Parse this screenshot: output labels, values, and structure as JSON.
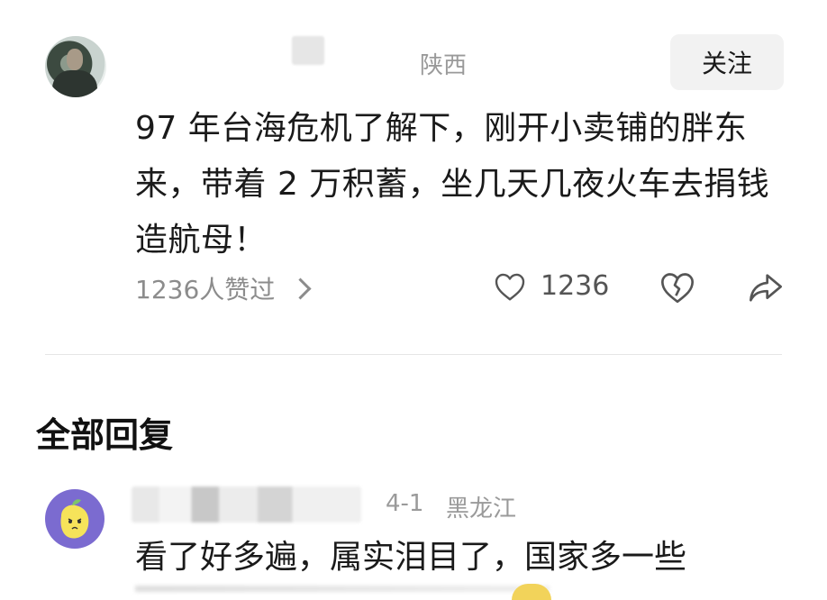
{
  "post": {
    "location": "陕西",
    "follow_label": "关注",
    "text": "97 年台海危机了解下，刚开小卖铺的胖东来，带着 2 万积蓄，坐几天几夜火车去捐钱造航母！",
    "likes_summary": "1236人赞过",
    "like_count": "1236"
  },
  "replies_section": {
    "title": "全部回复"
  },
  "reply": {
    "date": "4-1",
    "location": "黑龙江",
    "text": "看了好多遍，属实泪目了，国家多一些"
  },
  "colors": {
    "muted_text": "#9a9a9a",
    "button_bg": "#f2f2f2",
    "reply_avatar_bg": "#7b6bd0"
  }
}
